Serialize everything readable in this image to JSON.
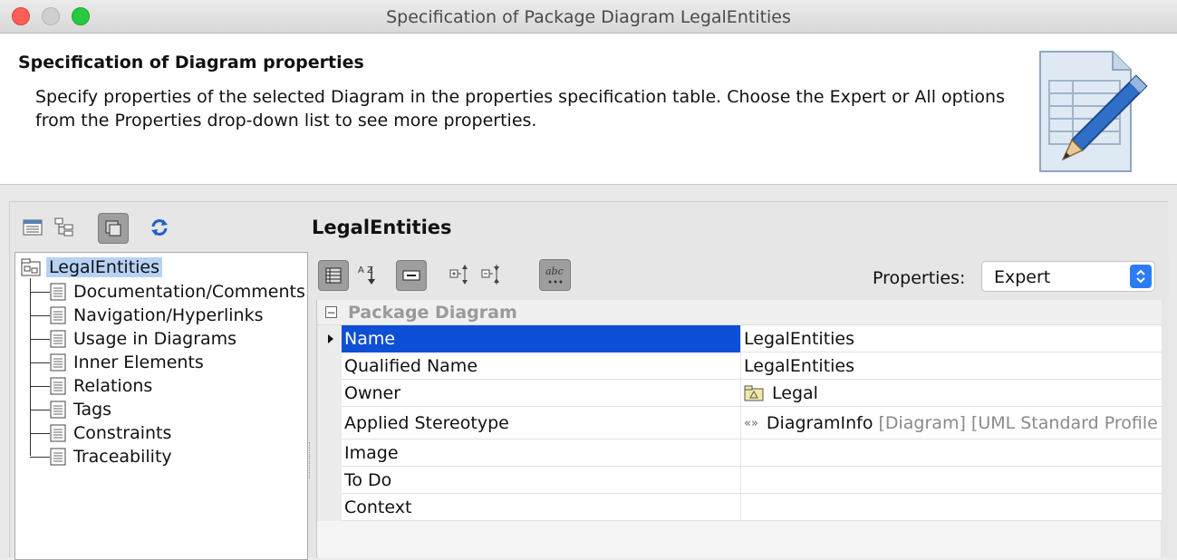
{
  "window": {
    "title": "Specification of Package Diagram LegalEntities"
  },
  "header": {
    "title": "Specification of Diagram properties",
    "description": "Specify properties of the selected Diagram in the properties specification table. Choose the Expert or All options from the Properties drop-down list to see more properties."
  },
  "tree": {
    "root": "LegalEntities",
    "items": [
      "Documentation/Comments",
      "Navigation/Hyperlinks",
      "Usage in Diagrams",
      "Inner Elements",
      "Relations",
      "Tags",
      "Constraints",
      "Traceability"
    ]
  },
  "main": {
    "entity_title": "LegalEntities",
    "properties_label": "Properties:",
    "properties_value": "Expert",
    "sort_icon_text": "A Z",
    "abc_icon_text": "abc"
  },
  "table": {
    "group": "Package Diagram",
    "rows": [
      {
        "name": "Name",
        "value": "LegalEntities"
      },
      {
        "name": "Qualified Name",
        "value": "LegalEntities"
      },
      {
        "name": "Owner",
        "value": "Legal"
      },
      {
        "name": "Applied Stereotype",
        "value": "DiagramInfo",
        "extra": "[Diagram] [UML Standard Profile"
      },
      {
        "name": "Image",
        "value": ""
      },
      {
        "name": "To Do",
        "value": ""
      },
      {
        "name": "Context",
        "value": ""
      }
    ]
  },
  "colors": {
    "selection_blue": "#0d4fd6",
    "tree_highlight": "#b7d2f3",
    "dropdown_accent": "#2b7cf5"
  }
}
